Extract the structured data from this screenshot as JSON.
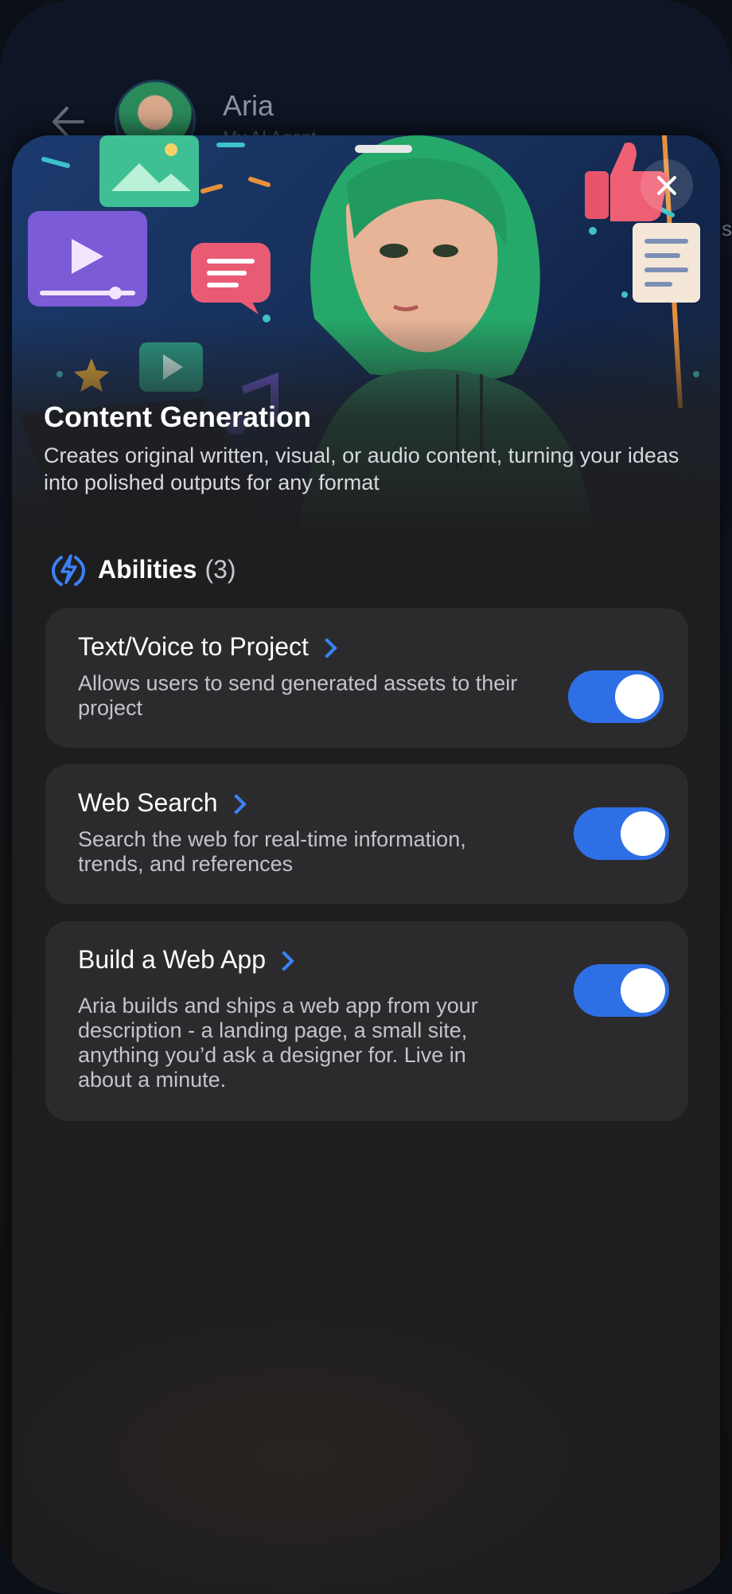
{
  "background": {
    "agent_name": "Aria",
    "agent_subtitle": "My AI Agent",
    "peek_char": "s"
  },
  "sheet": {
    "hero_title": "Content Generation",
    "hero_description": "Creates original written, visual, or audio content, turning your ideas into polished outputs for any format",
    "abilities_label": "Abilities",
    "abilities_count": "(3)",
    "abilities": [
      {
        "title": "Text/Voice to Project",
        "description": "Allows users to send generated assets to their project",
        "enabled": true
      },
      {
        "title": "Web Search",
        "description": "Search the web for real-time information, trends, and references",
        "enabled": true
      },
      {
        "title": "Build a Web App",
        "description": "Aria builds and ships a web app from your description - a landing page, a small site, anything you’d ask a designer for. Live in about a minute.",
        "enabled": true
      }
    ]
  },
  "colors": {
    "accent": "#2f6fe6",
    "card": "#2b2b2e",
    "sheet": "#1e1e20"
  },
  "icons": [
    "back-arrow-icon",
    "close-icon",
    "lightning-bolt-icon",
    "chevron-right-icon"
  ]
}
